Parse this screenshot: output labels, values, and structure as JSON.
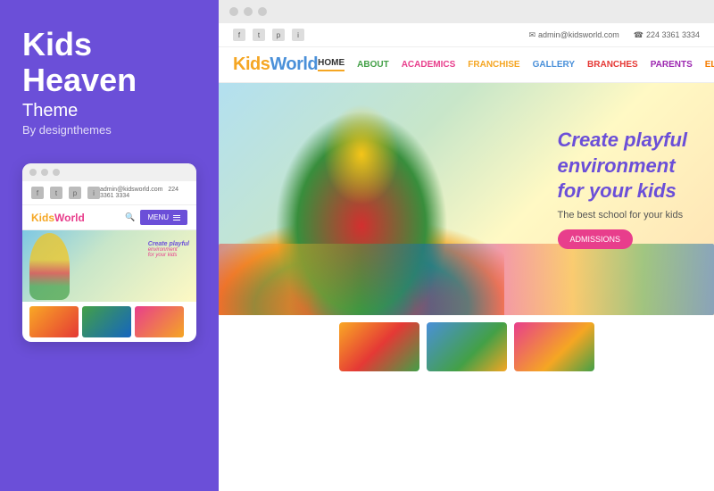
{
  "left": {
    "title_line1": "Kids",
    "title_line2": "Heaven",
    "subtitle": "Theme",
    "by": "By designthemes",
    "mini_card": {
      "logo_kids": "Kids",
      "logo_world": "World",
      "menu_label": "MENU",
      "hero_text_line1": "Create playful",
      "hero_text_line2": "environment",
      "hero_text_line3": "for your kids",
      "email": "admin@kidsworld.com",
      "phone": "224 3361 3334"
    }
  },
  "browser": {
    "topbar": {
      "email": "admin@kidsworld.com",
      "phone": "224 3361 3334",
      "social": [
        "f",
        "t",
        "p",
        "i"
      ]
    },
    "nav": {
      "logo_kids": "Kids",
      "logo_world": "World",
      "links": [
        {
          "label": "HOME",
          "class": "home"
        },
        {
          "label": "ABOUT",
          "class": "about"
        },
        {
          "label": "ACADEMICS",
          "class": "academics"
        },
        {
          "label": "FRANCHISE",
          "class": "franchise"
        },
        {
          "label": "GALLERY",
          "class": "gallery"
        },
        {
          "label": "BRANCHES",
          "class": "branches"
        },
        {
          "label": "PARENTS",
          "class": "parents"
        },
        {
          "label": "ELEMENTS",
          "class": "elements"
        }
      ]
    },
    "hero": {
      "tagline_line1": "Create playful",
      "tagline_line2": "environment",
      "tagline_line3": "for your kids",
      "sub": "The best school for your kids",
      "btn_label": "ADMISSIONS"
    }
  }
}
